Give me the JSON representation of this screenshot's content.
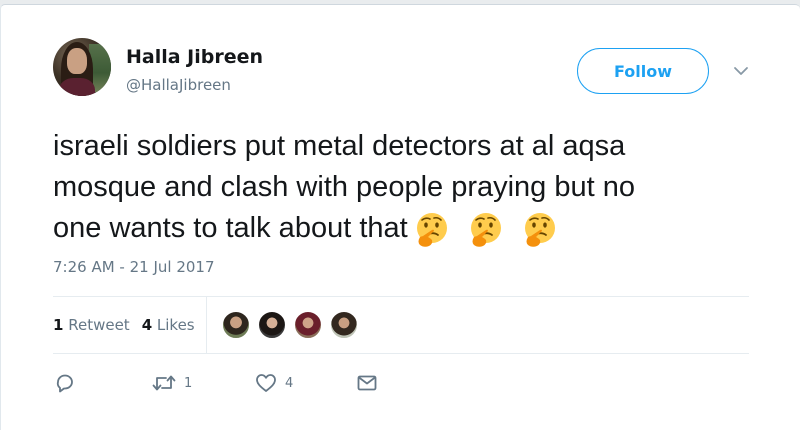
{
  "author": {
    "name": "Halla Jibreen",
    "handle": "@HallaJibreen"
  },
  "follow_button": {
    "label": "Follow"
  },
  "tweet": {
    "line1": "israeli soldiers put metal detectors at al aqsa",
    "line2": "mosque and clash with people praying but no",
    "line3": "one wants to talk about that",
    "emojis": [
      "thinking-face",
      "thinking-face",
      "thinking-face"
    ]
  },
  "timestamp": "7:26 AM - 21 Jul 2017",
  "stats": {
    "retweets_count": "1",
    "retweets_label": "Retweet",
    "likes_count": "4",
    "likes_label": "Likes"
  },
  "actions": {
    "reply": {
      "icon": "reply-icon",
      "count": ""
    },
    "retweet": {
      "icon": "retweet-icon",
      "count": "1"
    },
    "like": {
      "icon": "heart-icon",
      "count": "4"
    },
    "message": {
      "icon": "envelope-icon",
      "count": ""
    }
  },
  "colors": {
    "accent": "#1da1f2",
    "muted": "#657786",
    "text": "#14171a"
  }
}
